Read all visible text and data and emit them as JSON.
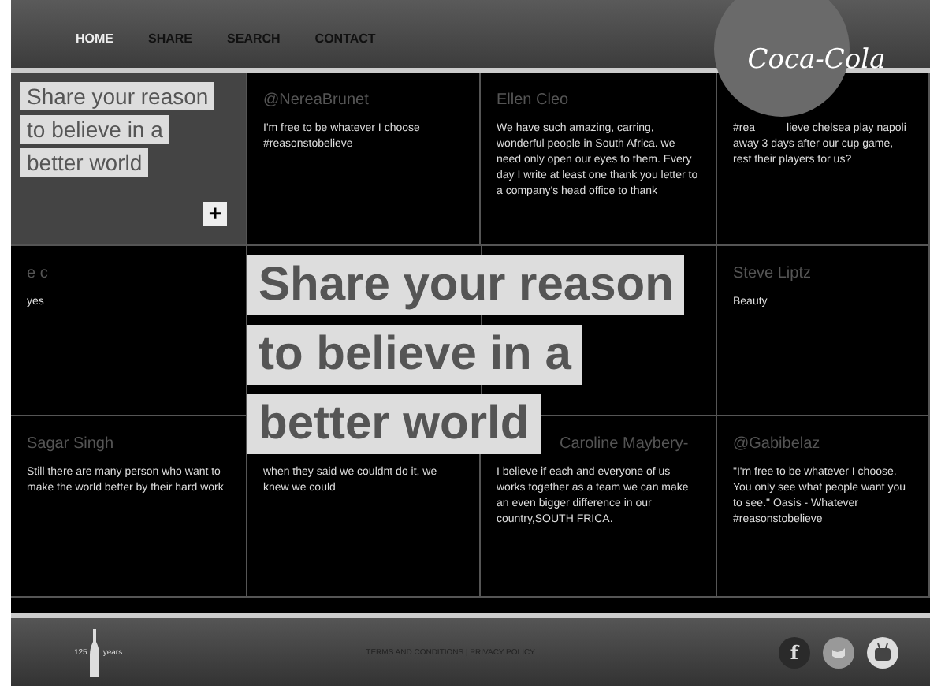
{
  "nav": [
    {
      "label": "HOME",
      "selected": true
    },
    {
      "label": "SHARE",
      "selected": false
    },
    {
      "label": "SEARCH",
      "selected": false
    },
    {
      "label": "CONTACT",
      "selected": false
    }
  ],
  "logo": {
    "text": "Coca-Cola"
  },
  "intro": {
    "lines": [
      "Share your reason",
      "to believe in a",
      "better world"
    ],
    "button": "+"
  },
  "posts": [
    {
      "name": "@NereaBrunet",
      "text": "I'm free to be whatever I choose #reasonstobelieve"
    },
    {
      "name": "Ellen Cleo",
      "text": "We have such amazing, carring, wonderful people in South Africa. we need only open our eyes to them.  Every day I write at least one thank you letter to a company's head office to thank"
    },
    {
      "text_start": "#rea",
      "text": "lieve chelsea play napoli away 3 days after our cup game, rest their players for us?"
    },
    {
      "name": "e c",
      "text": "yes"
    },
    {
      "name": "Steve Liptz",
      "text": "Beauty"
    },
    {
      "name": "Sagar Singh",
      "text": "Still there are many person who want to make the world better by their hard work"
    },
    {
      "text": "when they said we couldnt do it, we knew we could"
    },
    {
      "name": "Caroline Maybery-",
      "covered": true,
      "text": "I believe if each and everyone of us works together as a team we can make an even bigger difference in our country,SOUTH FRICA."
    },
    {
      "name": "@Gabibelaz",
      "text": "\"I'm free to be whatever I choose. You only see what people want you to see.\" Oasis - Whatever #reasonstobelieve"
    }
  ],
  "headline": {
    "lines": [
      "Share your reason",
      "to believe in a",
      "better world"
    ]
  },
  "footer": {
    "badge_number": "125",
    "badge_word": "years",
    "links": "TERMS AND CONDITIONS | PRIVACY POLICY",
    "social": [
      {
        "kind": "facebook",
        "label": "f"
      },
      {
        "kind": "twitter"
      },
      {
        "kind": "youtube"
      }
    ]
  }
}
